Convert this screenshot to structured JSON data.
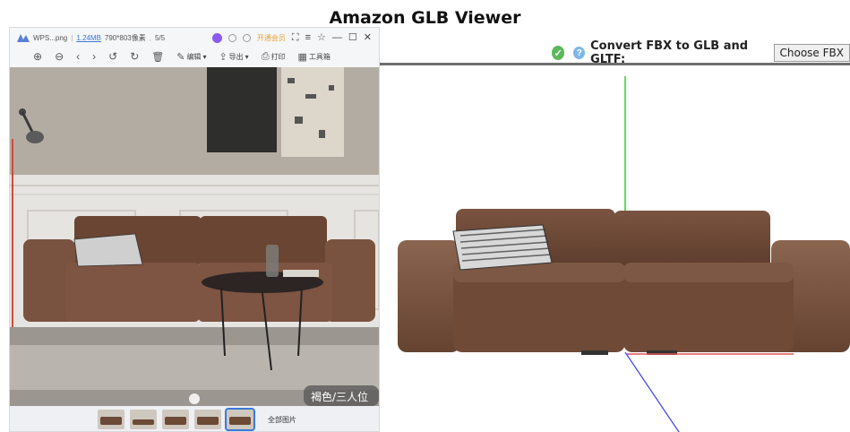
{
  "page": {
    "title": "Amazon GLB Viewer"
  },
  "converter": {
    "status_icon": "check-circle-icon",
    "help_icon": "help-circle-icon",
    "label": "Convert FBX to GLB and GLTF:",
    "choose_label": "Choose FBX",
    "accent": "#5cb85c"
  },
  "viewer": {
    "file_name": "WPS...png",
    "file_size": "1.24MB",
    "dimensions": "790*803像素",
    "page_index": "5/5",
    "vip_label": "开通会员",
    "edit_label": "编辑",
    "export_label": "导出",
    "print_label": "打印",
    "toolbox_label": "工具箱",
    "overlay_text": "褐色/三人位",
    "all_images_label": "全部图片",
    "accent": "#3a78d8"
  }
}
